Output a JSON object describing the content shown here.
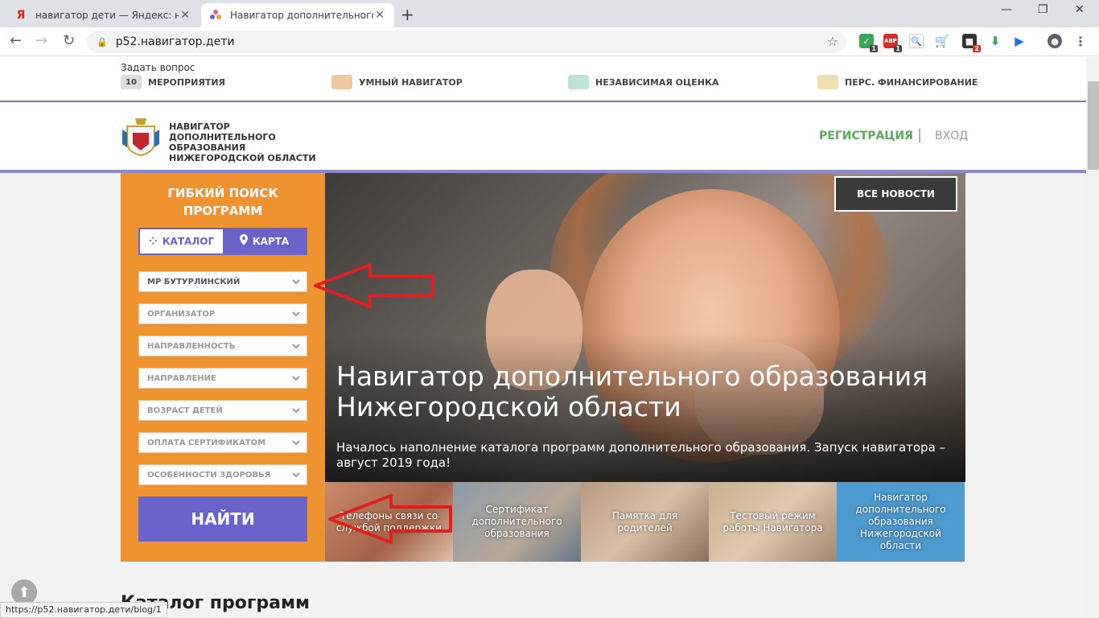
{
  "browser": {
    "tabs": [
      {
        "favicon": "yandex-icon",
        "title": "навигатор дети — Яндекс: нашлос"
      },
      {
        "favicon": "navigator-site-icon",
        "title": "Навигатор дополнительного об"
      }
    ],
    "new_tab_glyph": "+",
    "window_controls": {
      "minimize": "—",
      "maximize": "❐",
      "close": "✕"
    },
    "url": "p52.навигатор.дети",
    "extensions": [
      {
        "name": "extension-shield-icon",
        "color": "#3aa757",
        "badge": "1"
      },
      {
        "name": "extension-adblock-icon",
        "color": "#d93025",
        "badge": "1"
      },
      {
        "name": "extension-search-icon",
        "color": "#1a73e8",
        "badge": ""
      },
      {
        "name": "extension-cart-icon",
        "color": "#1a73e8",
        "badge": ""
      },
      {
        "name": "extension-dark-icon",
        "color": "#333333",
        "badge": "2"
      },
      {
        "name": "extension-download-icon",
        "color": "#3aa757",
        "badge": ""
      },
      {
        "name": "extension-play-icon",
        "color": "#1a73e8",
        "badge": ""
      }
    ]
  },
  "site": {
    "ask_question": "Задать вопрос",
    "top_menu": [
      {
        "icon": "calendar-icon",
        "icon_text": "10",
        "label": "МЕРОПРИЯТИЯ"
      },
      {
        "icon": "smart-navigator-icon",
        "icon_text": "",
        "label": "УМНЫЙ НАВИГАТОР"
      },
      {
        "icon": "rating-chart-icon",
        "icon_text": "",
        "label": "НЕЗАВИСИМАЯ ОЦЕНКА"
      },
      {
        "icon": "finance-icon",
        "icon_text": "",
        "label": "ПЕРС. ФИНАНСИРОВАНИЕ"
      }
    ],
    "logo_text": "НАВИГАТОР ДОПОЛНИТЕЛЬНОГО ОБРАЗОВАНИЯ НИЖЕГОРОДСКОЙ ОБЛАСТИ",
    "register": "РЕГИСТРАЦИЯ",
    "separator": "|",
    "login": "ВХОД",
    "search": {
      "title_line1": "ГИБКИЙ ПОИСК",
      "title_line2": "ПРОГРАММ",
      "tab_catalog": "КАТАЛОГ",
      "tab_map": "КАРТА",
      "filters": [
        "МР БУТУРЛИНСКИЙ",
        "ОРГАНИЗАТОР",
        "НАПРАВЛЕННОСТЬ",
        "НАПРАВЛЕНИЕ",
        "ВОЗРАСТ ДЕТЕЙ",
        "ОПЛАТА СЕРТИФИКАТОМ",
        "ОСОБЕННОСТИ ЗДОРОВЬЯ"
      ],
      "find_button": "НАЙТИ"
    },
    "hero": {
      "all_news": "ВСЕ НОВОСТИ",
      "title_line1": "Навигатор дополнительного образования",
      "title_line2": "Нижегородской области",
      "subtitle": "Началось наполнение каталога программ дополнительного образования. Запуск навигатора – август 2019 года!"
    },
    "news_tiles": [
      "Телефоны связи со службой поддержки",
      "Сертификат дополнительного образования",
      "Памятка для родителей",
      "Тестовый режим работы Навигатора",
      "Навигатор дополнительного образования Нижегородской области"
    ],
    "catalog_heading": "Каталог программ"
  },
  "status_url": "https://p52.навигатор.дети/blog/1",
  "colors": {
    "orange": "#ef9330",
    "purple": "#6a63c9",
    "green": "#5aab5a",
    "annotation_red": "#e02020"
  }
}
